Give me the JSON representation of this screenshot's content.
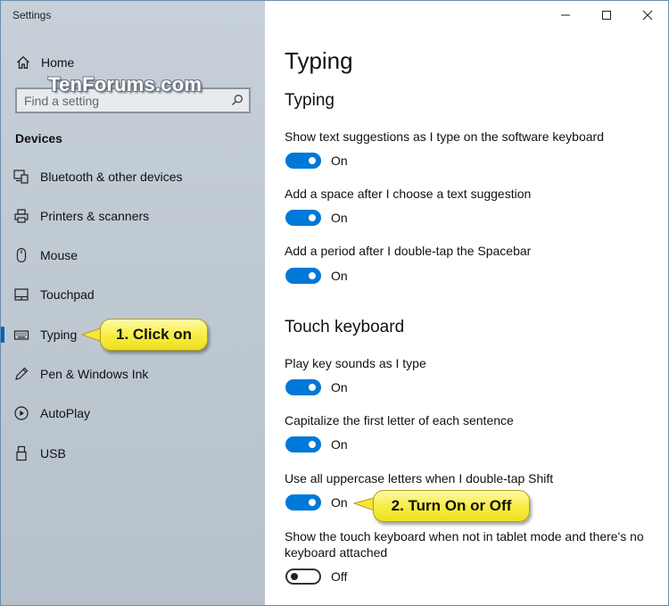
{
  "app": {
    "title": "Settings"
  },
  "sidebar": {
    "home_label": "Home",
    "search_placeholder": "Find a setting",
    "watermark": "TenForums.com",
    "section_label": "Devices",
    "items": [
      {
        "label": "Bluetooth & other devices",
        "icon": "bluetooth-devices-icon"
      },
      {
        "label": "Printers & scanners",
        "icon": "printer-icon"
      },
      {
        "label": "Mouse",
        "icon": "mouse-icon"
      },
      {
        "label": "Touchpad",
        "icon": "touchpad-icon"
      },
      {
        "label": "Typing",
        "icon": "keyboard-icon",
        "active": true
      },
      {
        "label": "Pen & Windows Ink",
        "icon": "pen-icon"
      },
      {
        "label": "AutoPlay",
        "icon": "autoplay-icon"
      },
      {
        "label": "USB",
        "icon": "usb-icon"
      }
    ]
  },
  "main": {
    "page_title": "Typing",
    "groups": [
      {
        "title": "Typing",
        "settings": [
          {
            "label": "Show text suggestions as I type on the software keyboard",
            "state": "On",
            "on": true
          },
          {
            "label": "Add a space after I choose a text suggestion",
            "state": "On",
            "on": true
          },
          {
            "label": "Add a period after I double-tap the Spacebar",
            "state": "On",
            "on": true
          }
        ]
      },
      {
        "title": "Touch keyboard",
        "settings": [
          {
            "label": "Play key sounds as I type",
            "state": "On",
            "on": true
          },
          {
            "label": "Capitalize the first letter of each sentence",
            "state": "On",
            "on": true
          },
          {
            "label": "Use all uppercase letters when I double-tap Shift",
            "state": "On",
            "on": true
          },
          {
            "label": "Show the touch keyboard when not in tablet mode and there's no keyboard attached",
            "state": "Off",
            "on": false
          }
        ]
      }
    ]
  },
  "callouts": {
    "step1": "1. Click on",
    "step2": "2. Turn On or Off"
  },
  "colors": {
    "accent": "#0078d7",
    "callout_fill": "#f7ec40",
    "sidebar_bg": "#c2ccd5"
  }
}
